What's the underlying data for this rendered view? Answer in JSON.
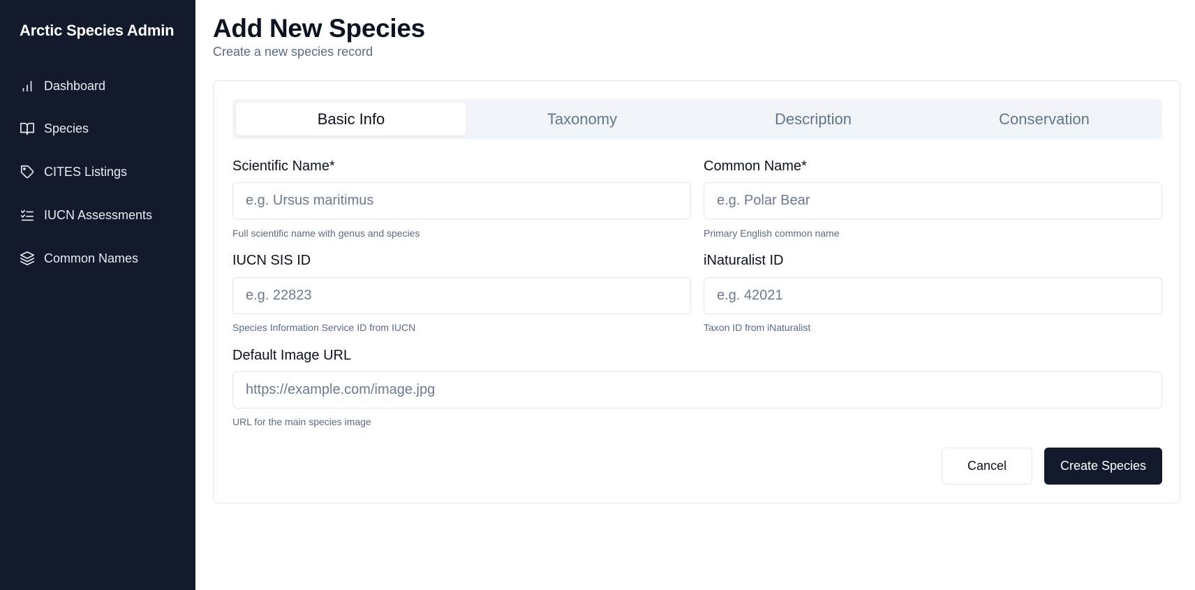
{
  "sidebar": {
    "app_title": "Arctic Species Admin",
    "items": [
      {
        "label": "Dashboard",
        "icon": "bar-chart-icon"
      },
      {
        "label": "Species",
        "icon": "book-icon"
      },
      {
        "label": "CITES Listings",
        "icon": "tag-icon"
      },
      {
        "label": "IUCN Assessments",
        "icon": "checklist-icon"
      },
      {
        "label": "Common Names",
        "icon": "layers-icon"
      }
    ]
  },
  "header": {
    "title": "Add New Species",
    "subtitle": "Create a new species record"
  },
  "tabs": [
    {
      "label": "Basic Info",
      "active": true
    },
    {
      "label": "Taxonomy",
      "active": false
    },
    {
      "label": "Description",
      "active": false
    },
    {
      "label": "Conservation",
      "active": false
    }
  ],
  "form": {
    "scientific_name": {
      "label": "Scientific Name*",
      "placeholder": "e.g. Ursus maritimus",
      "value": "",
      "help": "Full scientific name with genus and species"
    },
    "common_name": {
      "label": "Common Name*",
      "placeholder": "e.g. Polar Bear",
      "value": "",
      "help": "Primary English common name"
    },
    "iucn_sis_id": {
      "label": "IUCN SIS ID",
      "placeholder": "e.g. 22823",
      "value": "",
      "help": "Species Information Service ID from IUCN"
    },
    "inaturalist_id": {
      "label": "iNaturalist ID",
      "placeholder": "e.g. 42021",
      "value": "",
      "help": "Taxon ID from iNaturalist"
    },
    "default_image_url": {
      "label": "Default Image URL",
      "placeholder": "https://example.com/image.jpg",
      "value": "",
      "help": "URL for the main species image"
    }
  },
  "actions": {
    "cancel_label": "Cancel",
    "create_label": "Create Species"
  },
  "colors": {
    "sidebar_bg": "#121a2c",
    "primary_button": "#121a2c",
    "muted_text": "#5b6b82"
  }
}
